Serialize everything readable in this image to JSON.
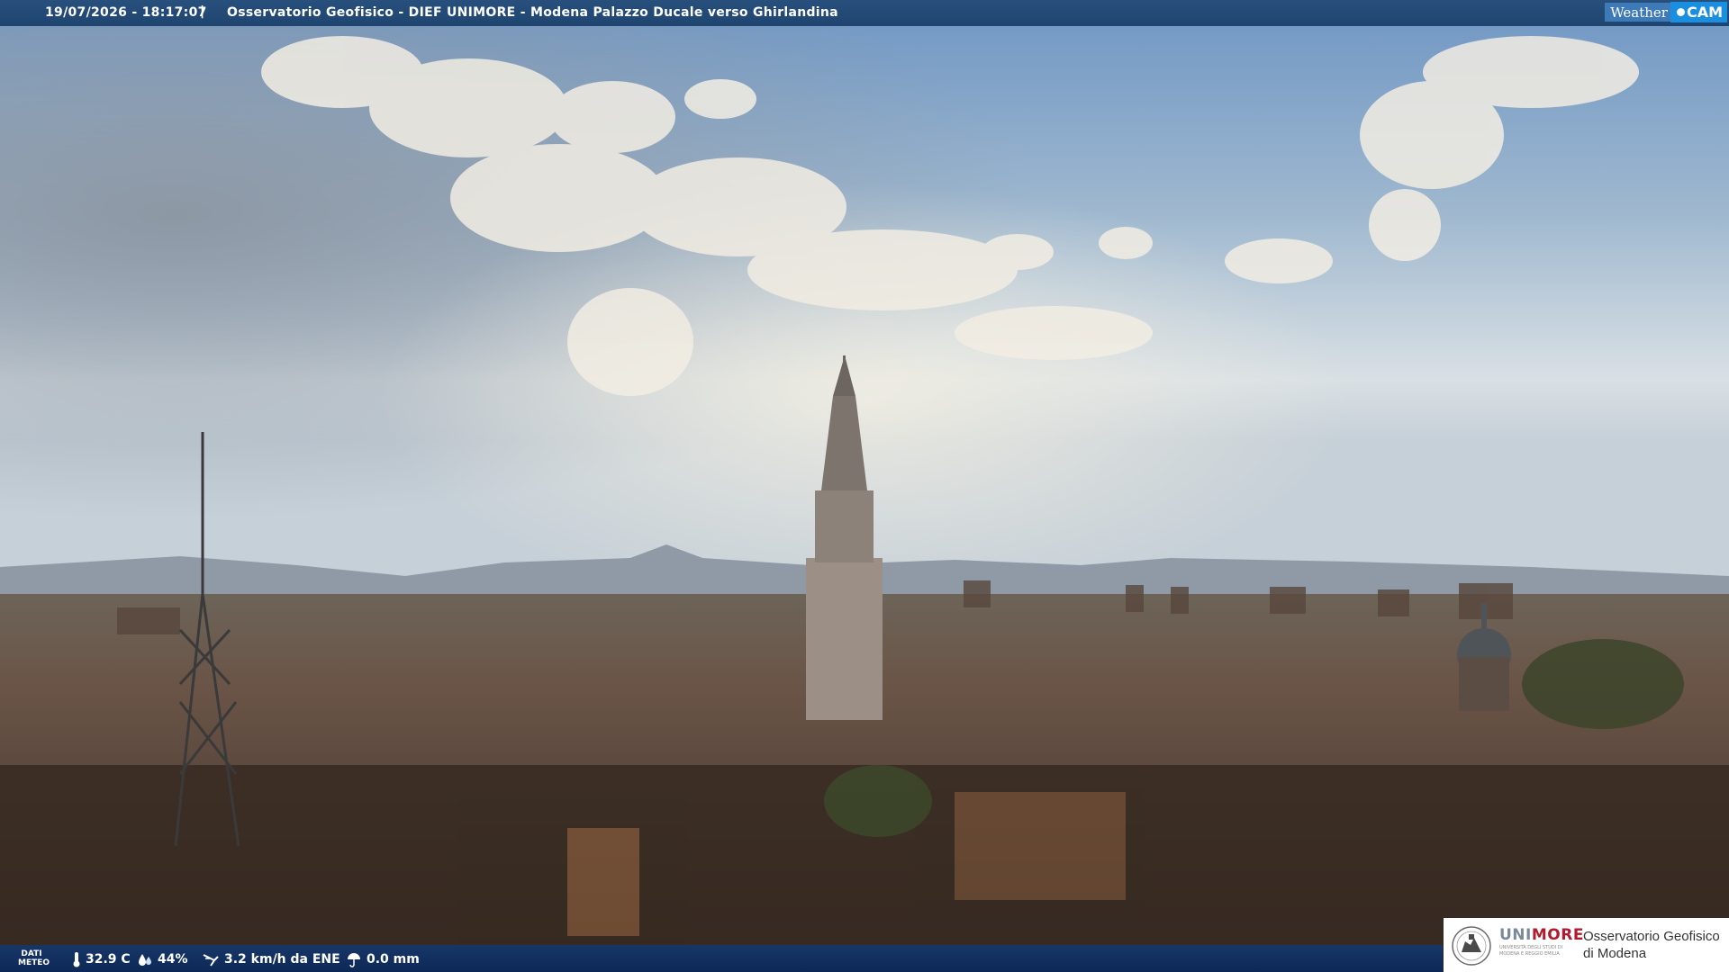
{
  "header": {
    "datetime": "19/07/2026 - 18:17:07",
    "separator": "|",
    "location_title": "Osservatorio Geofisico - DIEF UNIMORE - Modena Palazzo Ducale verso Ghirlandina"
  },
  "brand": {
    "part1": "Weather",
    "part2": "CAM"
  },
  "weather": {
    "section_label_line1": "DATI",
    "section_label_line2": "METEO",
    "temperature": "32.9 C",
    "humidity": "44%",
    "wind": "3.2 km/h da ENE",
    "rain": "0.0 mm"
  },
  "institution": {
    "uni_prefix": "UNI",
    "uni_suffix": "MORE",
    "uni_subtitle": "UNIVERSITÀ DEGLI STUDI DI MODENA E REGGIO EMILIA",
    "observatory_line1": "Osservatorio Geofisico",
    "observatory_line2": "di Modena"
  },
  "colors": {
    "bar_blue": "#1f4470",
    "brand_accent": "#1a8fe0",
    "unimore_red": "#b01b2e"
  }
}
